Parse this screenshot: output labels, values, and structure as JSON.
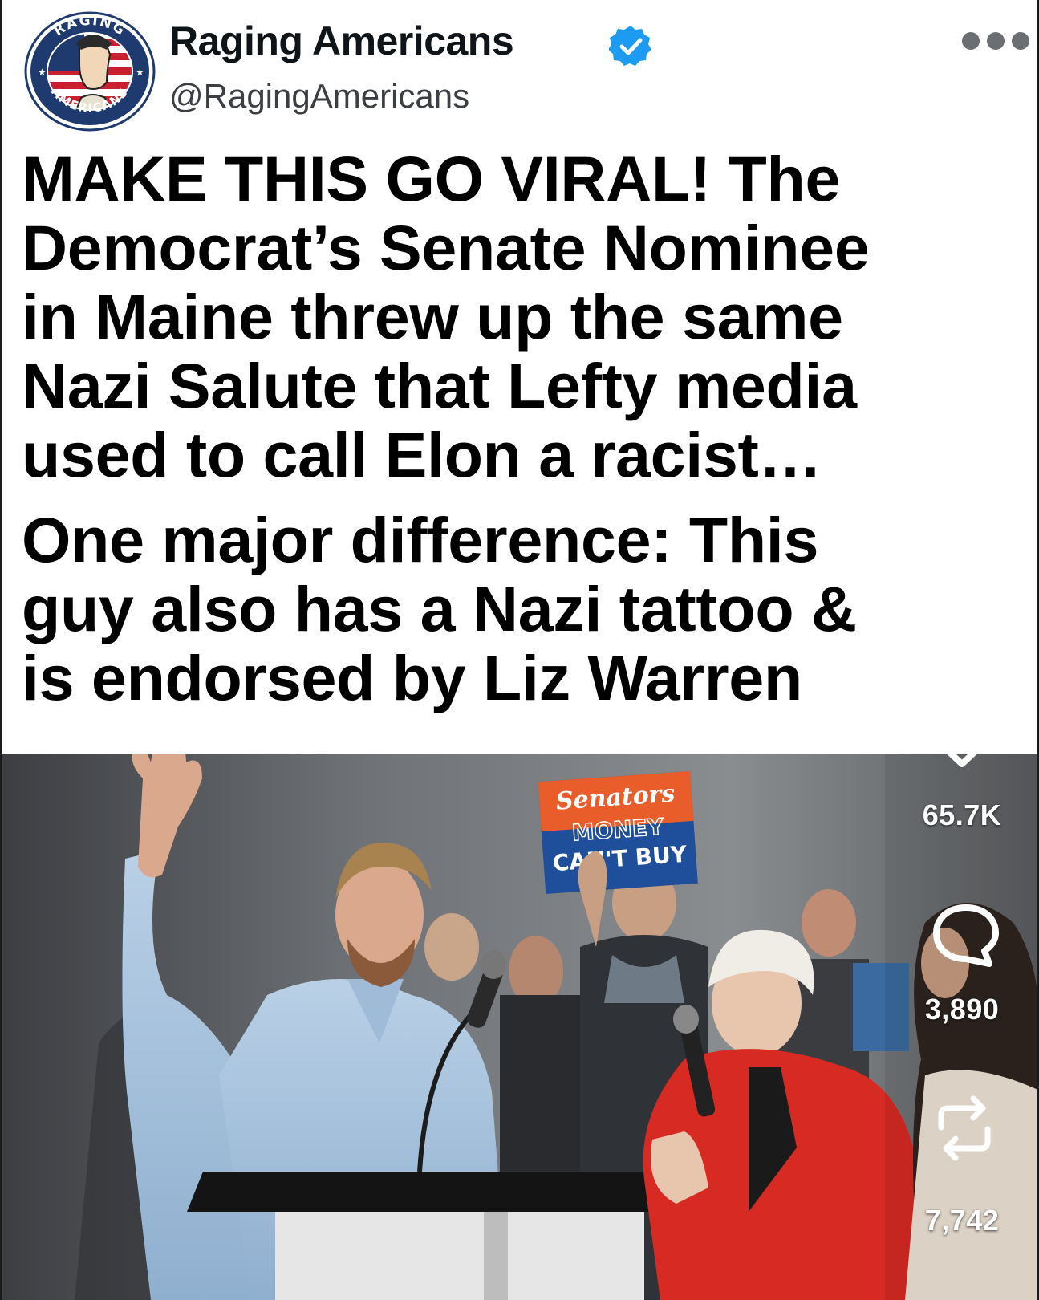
{
  "account": {
    "display_name": "Raging Americans",
    "handle": "@RagingAmericans",
    "verified": true,
    "avatar_text_top": "RAGING",
    "avatar_text_bottom": "AMERICANS"
  },
  "post": {
    "paragraphs": [
      "MAKE THIS GO VIRAL! The\nDemocrat’s Senate Nominee\nin Maine threw up the same\nNazi Salute that Lefty media\nused to call Elon a racist…",
      "One major difference: This\nguy also has a Nazi tattoo &\nis endorsed by Liz Warren"
    ]
  },
  "photo": {
    "sign_line1": "Senators",
    "sign_line2": "MONEY",
    "sign_line3": "CAN'T BUY"
  },
  "actions": {
    "likes": "65.7K",
    "comments": "3,890",
    "reposts": "7,742"
  },
  "icons": {
    "like": "heart-icon",
    "comment": "comment-icon",
    "repost": "repost-icon",
    "more": "more-options-icon",
    "verified": "verified-badge-icon"
  },
  "colors": {
    "verified_blue": "#1d9bf0",
    "text": "#0f1419",
    "handle_gray": "#3b3f44",
    "sign_orange": "#e85d2a",
    "sign_blue": "#1f4e9a"
  }
}
